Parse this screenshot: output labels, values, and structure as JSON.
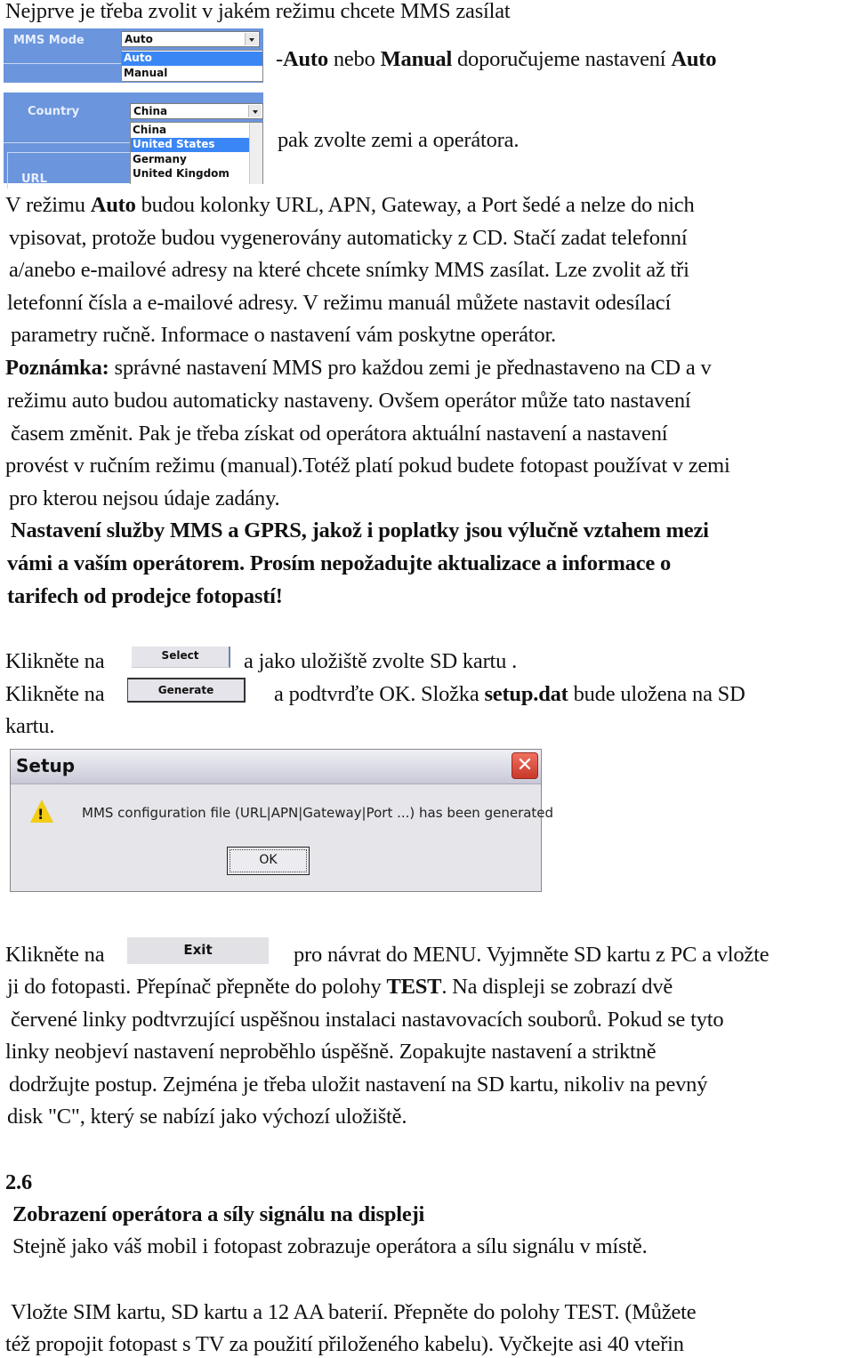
{
  "intro": {
    "line1": "Nejprve je třeba zvolit v jakém režimu chcete MMS zasílat",
    "mode_hint_prefix": "-",
    "mode_hint_auto": "Auto",
    "mode_hint_or": " nebo ",
    "mode_hint_manual": "Manual",
    "mode_hint_rec": " doporučujeme nastavení ",
    "mode_hint_auto2": "Auto",
    "country_hint": "pak zvolte zemi a operátora."
  },
  "mms_mode_panel": {
    "label": "MMS Mode",
    "selected": "Auto",
    "options": [
      {
        "label": "Auto",
        "highlighted": true
      },
      {
        "label": "Manual",
        "highlighted": false
      }
    ]
  },
  "country_panel": {
    "label": "Country",
    "selected": "China",
    "options": [
      {
        "label": "China",
        "highlighted": false
      },
      {
        "label": "United States",
        "highlighted": true
      },
      {
        "label": "Germany",
        "highlighted": false
      },
      {
        "label": "United Kingdom",
        "highlighted": false
      }
    ],
    "next_label": "URL"
  },
  "para1": {
    "l1_a": "V režimu ",
    "l1_b": "Auto",
    "l1_c": " budou kolonky URL, APN, Gateway, a Port šedé a nelze do nich",
    "l2": "vpisovat, protože budou vygenerovány automaticky z CD. Stačí zadat telefonní",
    "l3": "a/anebo e-mailové adresy na které chcete snímky MMS zasílat. Lze zvolit až tři",
    "l4": "letefonní čísla a e-mailové adresy. V režimu manuál můžete nastavit odesílací",
    "l5": "parametry ručně. Informace o nastavení vám poskytne operátor."
  },
  "note": {
    "label": "Poznámka:",
    "l1": " správné nastavení MMS pro každou zemi je přednastaveno na CD a v",
    "l2": "režimu auto budou automaticky nastaveny. Ovšem operátor může tato nastavení",
    "l3": "časem změnit. Pak je třeba získat od operátora aktuální nastavení a nastavení",
    "l4": "provést v ručním režimu (manual).Totéž platí pokud budete fotopast používat v zemi",
    "l5": "pro kterou nejsou údaje zadány."
  },
  "warning": {
    "l1": "Nastavení služby MMS a GPRS, jakož i poplatky jsou výlučně vztahem mezi",
    "l2": "vámi a vaším operátorem. Prosím nepožadujte aktualizace a informace o",
    "l3": "tarifech od prodejce fotopastí!"
  },
  "steps": {
    "click_on": "Klikněte na",
    "select_button": "Select",
    "select_after": "a jako uložiště zvolte SD kartu .",
    "generate_button": "Generate",
    "generate_after_a": "a podtvrďte OK. Složka ",
    "generate_after_b": "setup.dat",
    "generate_after_c": " bude uložena na SD",
    "generate_after_l2": "kartu."
  },
  "dialog": {
    "title": "Setup",
    "message": "MMS configuration file (URL|APN|Gateway|Port ...) has been generated",
    "ok_label": "OK",
    "close_glyph": "✕",
    "warning_glyph": "!"
  },
  "exit_step": {
    "click_on": "Klikněte na",
    "exit_button": "Exit",
    "l1": "pro návrat do MENU. Vyjmněte SD kartu z PC a vložte",
    "l2_a": "ji do fotopasti. Přepínač přepněte do polohy ",
    "l2_b": "TEST",
    "l2_c": ". Na displeji se zobrazí dvě",
    "l3": "červené linky podtvrzující uspěšnou instalaci nastavovacích souborů. Pokud se tyto",
    "l4": "linky neobjeví nastavení neproběhlo úspěšně. Zopakujte nastavení a striktně",
    "l5": "dodržujte postup. Zejména je třeba uložit nastavení na SD kartu, nikoliv na pevný",
    "l6": "disk \"C\", který se nabízí jako výchozí uložiště."
  },
  "section": {
    "number": "2.6",
    "title": "Zobrazení operátora a síly signálu na displeji",
    "l1": "Stejně jako váš mobil i fotopast zobrazuje operátora a sílu signálu v místě.",
    "l2": "Vložte SIM kartu, SD kartu  a  12 AA baterií. Přepněte do polohy TEST. (Můžete",
    "l3": "též propojit fotopast s TV  za použití přiloženého kabelu). Vyčkejte asi 40 vteřin"
  }
}
